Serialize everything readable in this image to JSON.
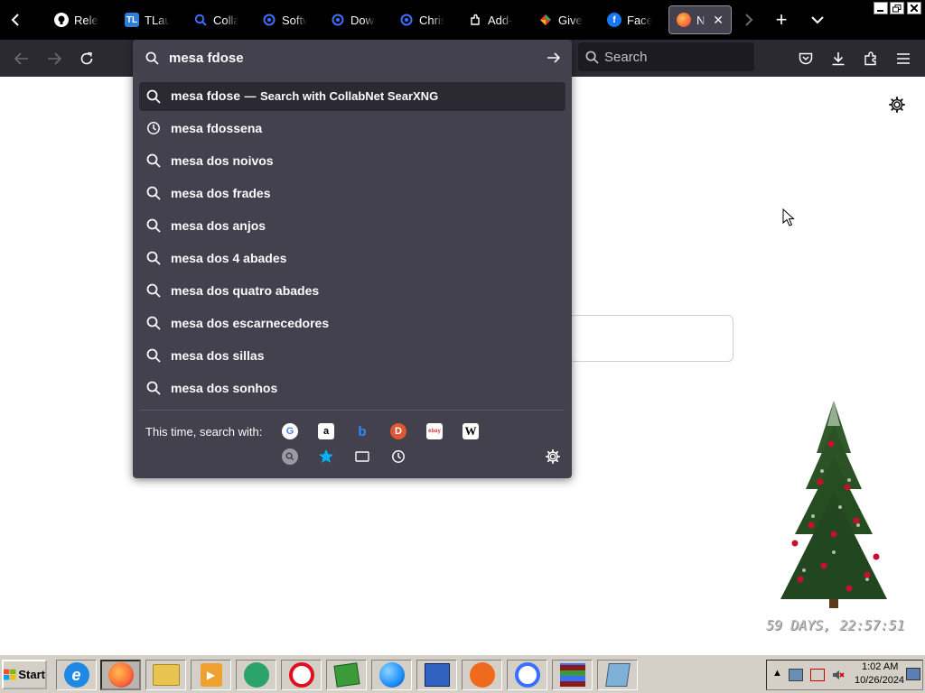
{
  "tabs": [
    {
      "title": "Release",
      "favicon": "github-icon",
      "color": "#ffffff"
    },
    {
      "title": "TLauncher",
      "favicon": "tl-icon",
      "color": "#2f7fd8"
    },
    {
      "title": "CollabNet",
      "favicon": "search-icon",
      "color": "#3b6fff"
    },
    {
      "title": "Software",
      "favicon": "searxng-icon",
      "color": "#3b6fff"
    },
    {
      "title": "Download",
      "favicon": "searxng-icon",
      "color": "#3b6fff"
    },
    {
      "title": "Christmas",
      "favicon": "searxng-icon",
      "color": "#3b6fff"
    },
    {
      "title": "Add-ons",
      "favicon": "puzzle-icon",
      "color": "#ffffff"
    },
    {
      "title": "Giveaway",
      "favicon": "giveaway-icon",
      "color": "#e23c3c"
    },
    {
      "title": "Facebook",
      "favicon": "facebook-icon",
      "color": "#1877f2"
    },
    {
      "title": "New Tab",
      "favicon": "firefox-icon",
      "color": "#ff7139",
      "active": true
    }
  ],
  "tab_labels": {
    "tl": "TL",
    "new_tab": "+"
  },
  "nav": {
    "search_placeholder": "Search"
  },
  "urlbar": {
    "input_value": "mesa fdose",
    "first_suggestion": "mesa fdose",
    "first_separator": "—",
    "first_action": "Search with CollabNet SearXNG",
    "suggestions": [
      {
        "text": "mesa fdossena",
        "icon": "history-icon"
      },
      {
        "text": "mesa dos noivos",
        "icon": "search-icon"
      },
      {
        "text": "mesa dos frades",
        "icon": "search-icon"
      },
      {
        "text": "mesa dos anjos",
        "icon": "search-icon"
      },
      {
        "text": "mesa dos 4 abades",
        "icon": "search-icon"
      },
      {
        "text": "mesa dos quatro abades",
        "icon": "search-icon"
      },
      {
        "text": "mesa dos escarnecedores",
        "icon": "search-icon"
      },
      {
        "text": "mesa dos sillas",
        "icon": "search-icon"
      },
      {
        "text": "mesa dos sonhos",
        "icon": "search-icon"
      }
    ],
    "oneoff_label": "This time, search with:",
    "engines": [
      {
        "name": "google-icon",
        "glyph": "G"
      },
      {
        "name": "amazon-icon",
        "glyph": "a"
      },
      {
        "name": "bing-icon",
        "glyph": "b"
      },
      {
        "name": "duckduckgo-icon",
        "glyph": "D"
      },
      {
        "name": "ebay-icon",
        "glyph": "ebay"
      },
      {
        "name": "wikipedia-icon",
        "glyph": "W"
      }
    ]
  },
  "widget": {
    "countdown": "59 DAYS, 22:57:51"
  },
  "taskbar": {
    "start_label": "Start",
    "clock_time": "1:02 AM",
    "clock_date": "10/26/2024",
    "apps": [
      {
        "name": "internet-explorer-icon",
        "glyph": "e",
        "color": "#1e88e5"
      },
      {
        "name": "firefox-icon",
        "glyph": "",
        "color": "#ff7139",
        "pressed": true
      },
      {
        "name": "file-explorer-icon",
        "glyph": "",
        "color": "#e8c350"
      },
      {
        "name": "media-player-icon",
        "glyph": "▶",
        "color": "#f0a030"
      },
      {
        "name": "messenger-icon",
        "glyph": "",
        "color": "#2aa36b"
      },
      {
        "name": "opera-icon",
        "glyph": "O",
        "color": "#e0101e"
      },
      {
        "name": "package-icon",
        "glyph": "",
        "color": "#3b9b3b"
      },
      {
        "name": "browser-icon",
        "glyph": "",
        "color": "#1e90ff"
      },
      {
        "name": "network-icon",
        "glyph": "",
        "color": "#3060c0"
      },
      {
        "name": "avast-icon",
        "glyph": "",
        "color": "#f06a1e"
      },
      {
        "name": "searxng-app-icon",
        "glyph": "",
        "color": "#3b6fff"
      },
      {
        "name": "winrar-icon",
        "glyph": "",
        "color": "#8b1a1a"
      },
      {
        "name": "notepad-icon",
        "glyph": "",
        "color": "#7fb0d8"
      }
    ]
  }
}
